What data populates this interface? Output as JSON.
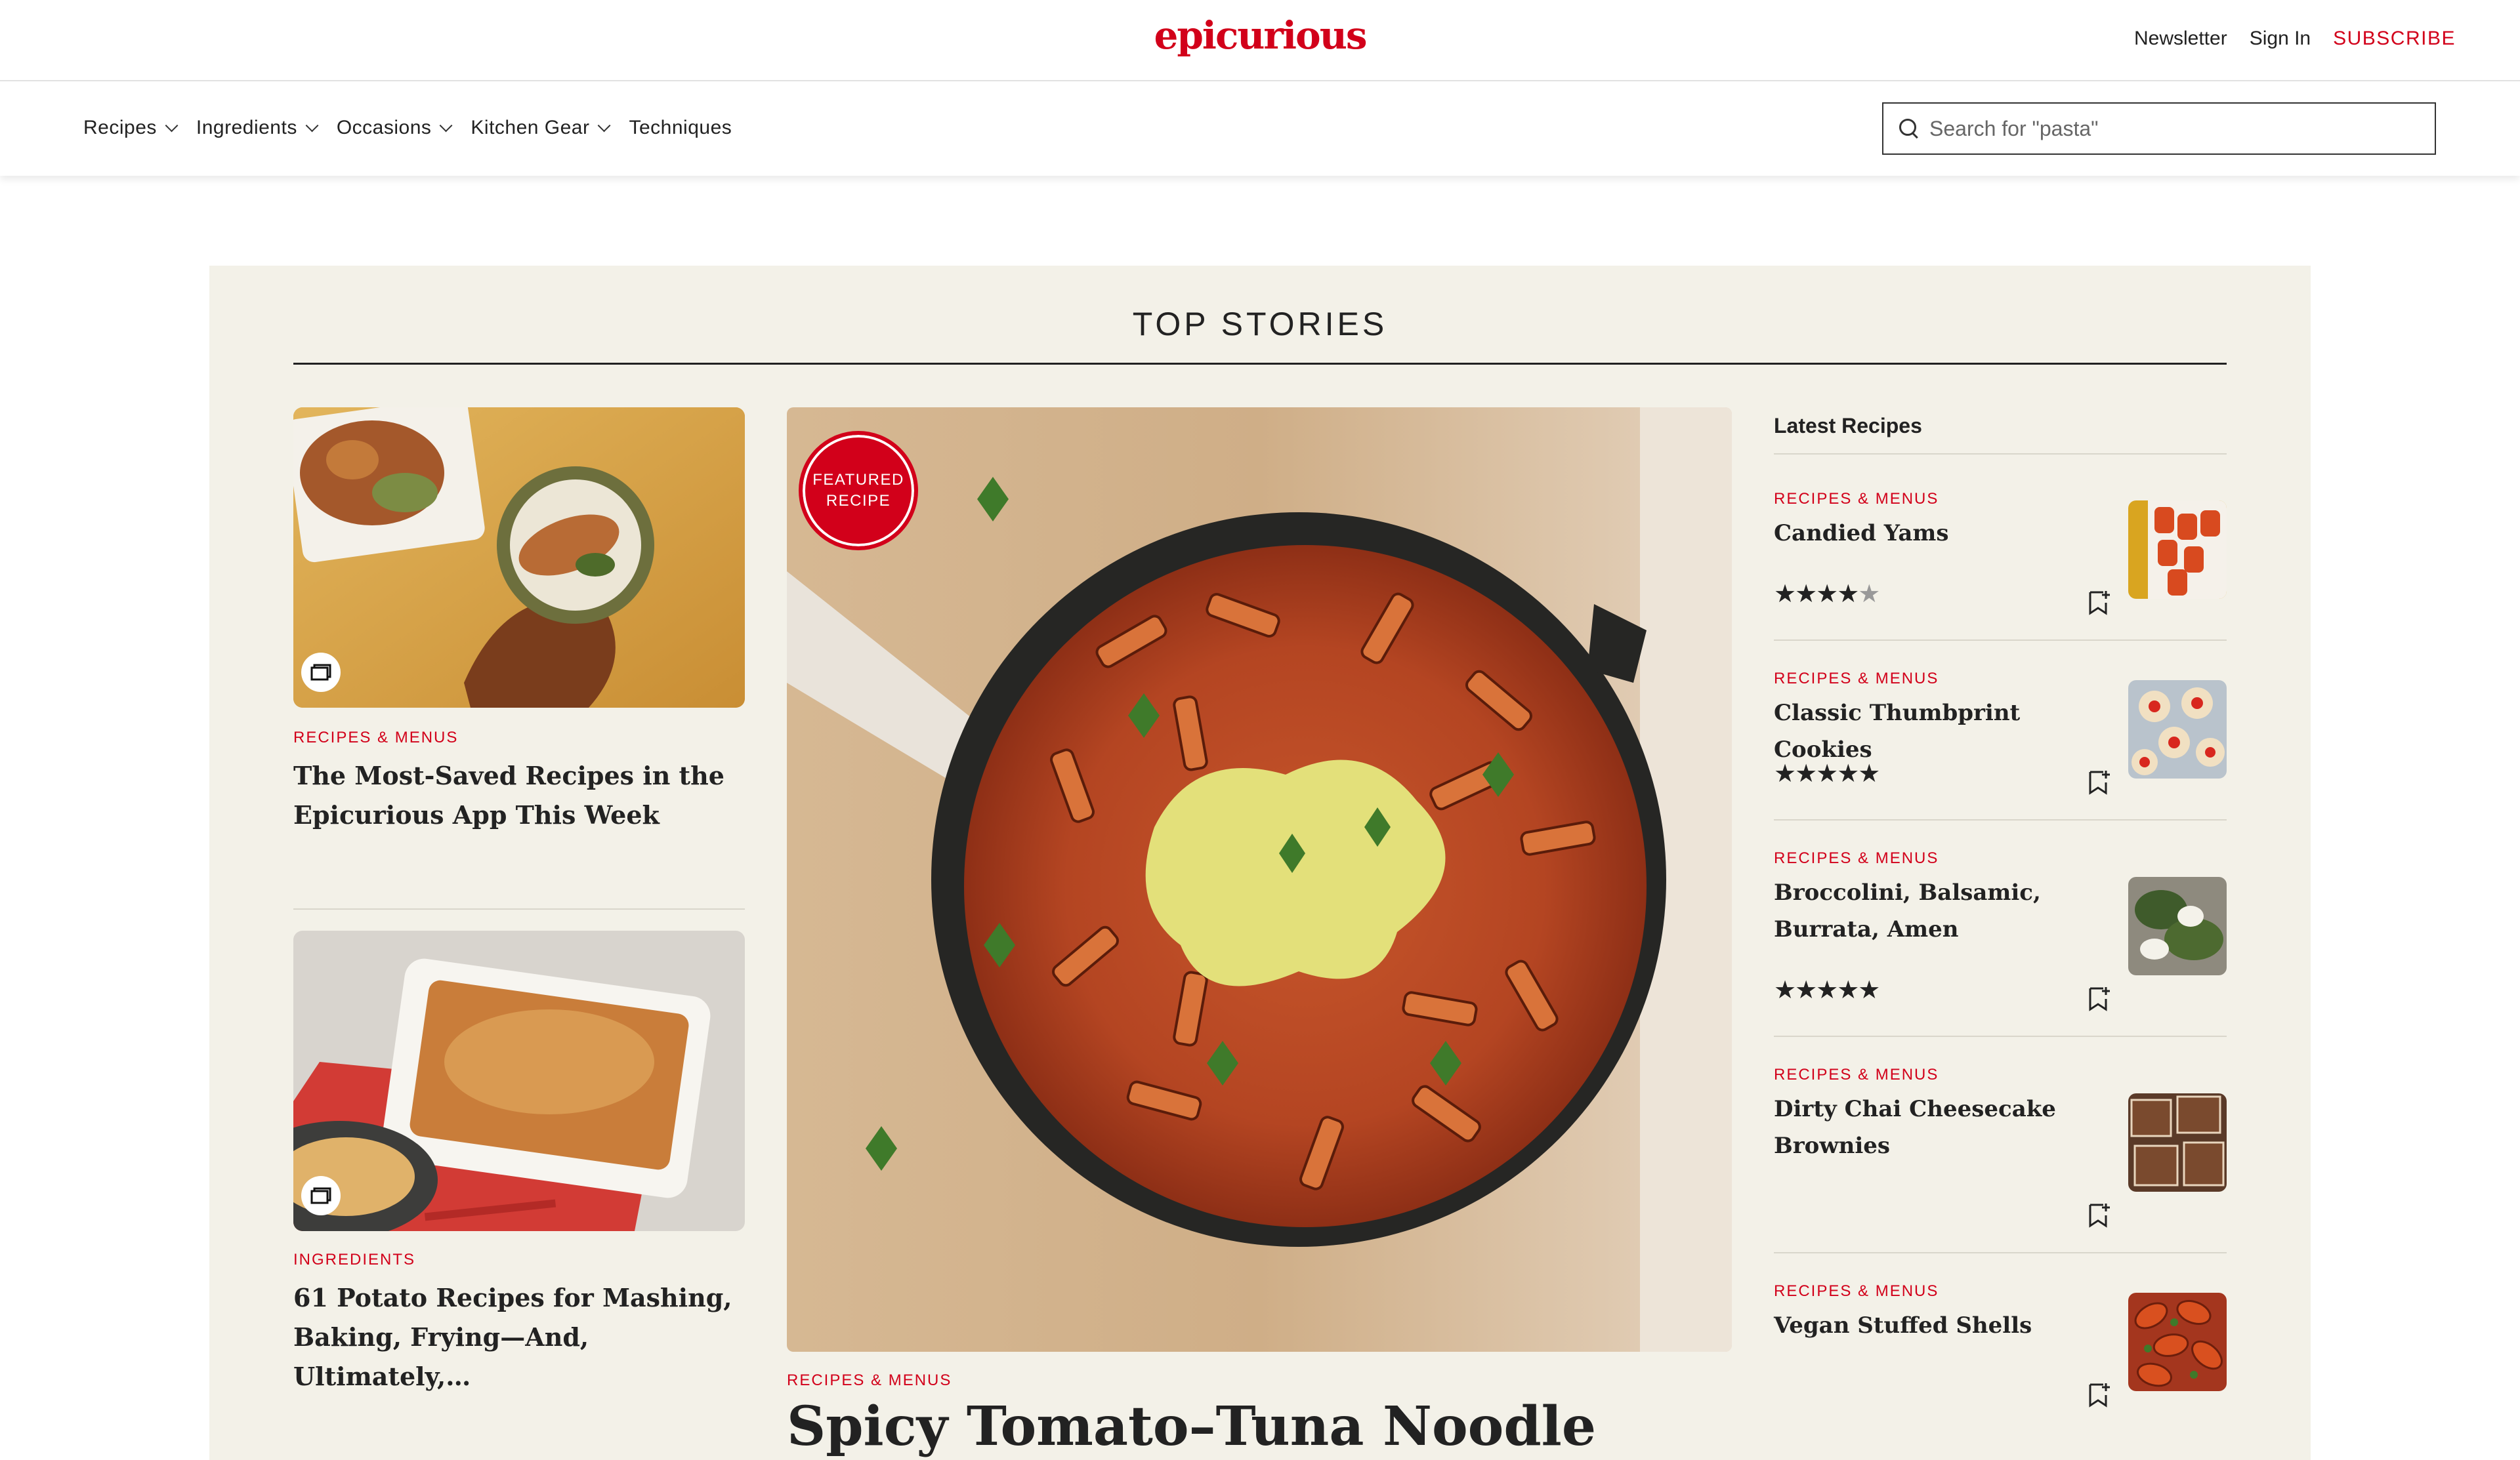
{
  "header": {
    "logo": "epicurious",
    "newsletter": "Newsletter",
    "sign_in": "Sign In",
    "subscribe": "SUBSCRIBE"
  },
  "nav": {
    "items": [
      {
        "label": "Recipes",
        "dropdown": true
      },
      {
        "label": "Ingredients",
        "dropdown": true
      },
      {
        "label": "Occasions",
        "dropdown": true
      },
      {
        "label": "Kitchen Gear",
        "dropdown": true
      },
      {
        "label": "Techniques",
        "dropdown": false
      }
    ],
    "search_placeholder": "Search for \"pasta\""
  },
  "top_stories": {
    "title": "TOP STORIES",
    "left_cards": [
      {
        "kicker": "RECIPES & MENUS",
        "headline": "The Most-Saved Recipes in the Epicurious App This Week",
        "gallery_icon": "gallery-icon"
      },
      {
        "kicker": "INGREDIENTS",
        "headline": "61 Potato Recipes for Mashing, Baking, Frying—And, Ultimately,…",
        "gallery_icon": "gallery-icon"
      }
    ],
    "featured": {
      "badge_line1": "FEATURED",
      "badge_line2": "RECIPE",
      "kicker": "RECIPES & MENUS",
      "headline": "Spicy Tomato–Tuna Noodle Skillet"
    }
  },
  "latest": {
    "title": "Latest Recipes",
    "items": [
      {
        "kicker": "RECIPES & MENUS",
        "title": "Candied Yams",
        "rating": 4.5,
        "stars": "★★★★",
        "half": "★"
      },
      {
        "kicker": "RECIPES & MENUS",
        "title": "Classic Thumbprint Cookies",
        "rating": 5,
        "stars": "★★★★★",
        "half": ""
      },
      {
        "kicker": "RECIPES & MENUS",
        "title": "Broccolini, Balsamic, Burrata, Amen",
        "rating": 5,
        "stars": "★★★★★",
        "half": ""
      },
      {
        "kicker": "RECIPES & MENUS",
        "title": "Dirty Chai Cheesecake Brownies",
        "rating": null,
        "stars": "",
        "half": ""
      },
      {
        "kicker": "RECIPES & MENUS",
        "title": "Vegan Stuffed Shells",
        "rating": null,
        "stars": "",
        "half": ""
      }
    ]
  },
  "colors": {
    "brand_red": "#d2001a",
    "panel_bg": "#f3f1e8"
  }
}
